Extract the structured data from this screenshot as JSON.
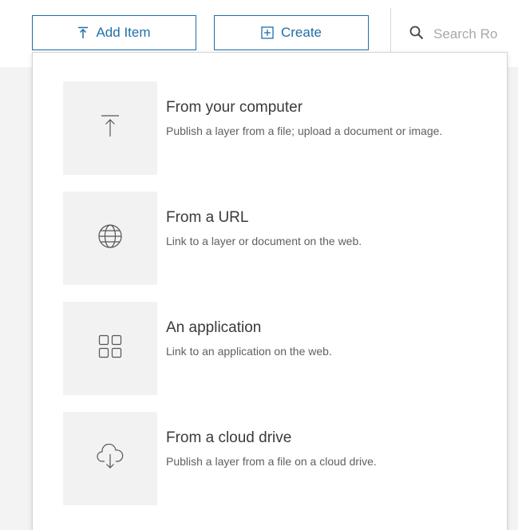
{
  "toolbar": {
    "add_item_label": "Add Item",
    "create_label": "Create",
    "search_placeholder": "Search Ro"
  },
  "menu": {
    "items": [
      {
        "title": "From your computer",
        "description": "Publish a layer from a file; upload a document or image.",
        "icon": "upload-icon"
      },
      {
        "title": "From a URL",
        "description": "Link to a layer or document on the web.",
        "icon": "globe-icon"
      },
      {
        "title": "An application",
        "description": "Link to an application on the web.",
        "icon": "grid-icon"
      },
      {
        "title": "From a cloud drive",
        "description": "Publish a layer from a file on a cloud drive.",
        "icon": "cloud-download-icon"
      }
    ]
  },
  "colors": {
    "accent": "#1f6fa8",
    "tile_background": "#f2f2f2",
    "page_background": "#f3f3f3"
  }
}
